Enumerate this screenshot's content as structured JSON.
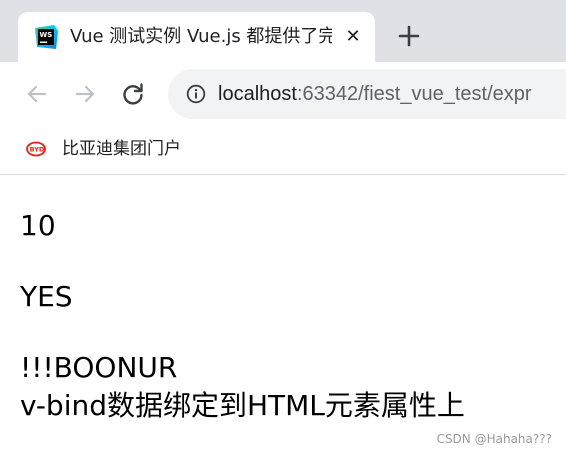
{
  "tab": {
    "title": "Vue 测试实例 Vue.js 都提供了完",
    "favicon": "webstorm-icon",
    "close_icon": "close-icon",
    "close_glyph": "✕"
  },
  "toolbar": {
    "back_icon": "back-arrow-icon",
    "forward_icon": "forward-arrow-icon",
    "reload_icon": "reload-icon",
    "info_icon": "info-icon",
    "url_host": "localhost",
    "url_path": ":63342/fiest_vue_test/expr"
  },
  "bookmarks": {
    "items": [
      {
        "label": "比亚迪集团门户",
        "icon": "byd-logo-icon"
      }
    ]
  },
  "page": {
    "lines": [
      "10",
      "YES",
      "!!!BOONUR",
      "v-bind数据绑定到HTML元素属性上"
    ],
    "watermark": "CSDN @Hahaha???"
  },
  "colors": {
    "tabstrip_bg": "#dee1e6",
    "omnibox_bg": "#f1f3f4",
    "byd_red": "#e2231a"
  }
}
